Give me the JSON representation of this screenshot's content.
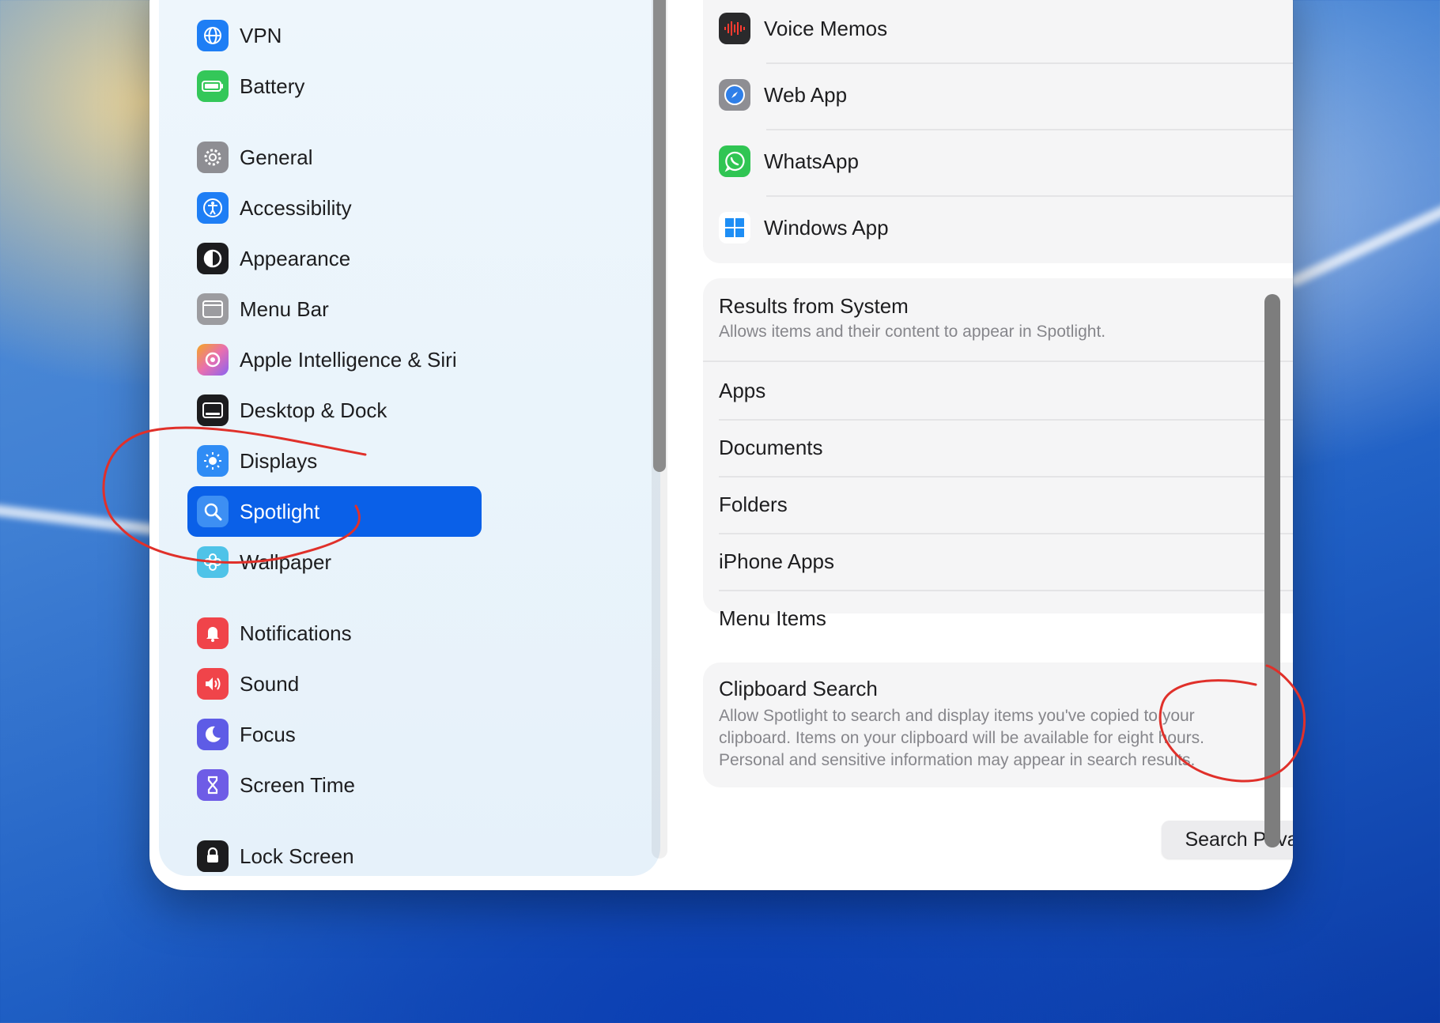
{
  "sidebar": {
    "items": [
      {
        "label": "VPN",
        "icon": "globe-icon",
        "color": "#1e7ef5"
      },
      {
        "label": "Battery",
        "icon": "battery-icon",
        "color": "#34c759"
      },
      {
        "label": "General",
        "icon": "gear-icon",
        "color": "#8e8e93"
      },
      {
        "label": "Accessibility",
        "icon": "accessibility-icon",
        "color": "#1e7ef5"
      },
      {
        "label": "Appearance",
        "icon": "appearance-icon",
        "color": "#1c1c1e"
      },
      {
        "label": "Menu Bar",
        "icon": "menu-bar-icon",
        "color": "#9c9ca0"
      },
      {
        "label": "Apple Intelligence & Siri",
        "icon": "apple-intelligence-icon",
        "color": "#e86fb0"
      },
      {
        "label": "Desktop & Dock",
        "icon": "desktop-dock-icon",
        "color": "#1c1c1e"
      },
      {
        "label": "Displays",
        "icon": "sun-icon",
        "color": "#2f8cf5"
      },
      {
        "label": "Spotlight",
        "icon": "magnifier-icon",
        "color": "#2e84f0",
        "selected": true
      },
      {
        "label": "Wallpaper",
        "icon": "flower-icon",
        "color": "#4fc3e8"
      },
      {
        "label": "Notifications",
        "icon": "bell-icon",
        "color": "#f0444a"
      },
      {
        "label": "Sound",
        "icon": "speaker-icon",
        "color": "#f0444a"
      },
      {
        "label": "Focus",
        "icon": "moon-icon",
        "color": "#5e5ce6"
      },
      {
        "label": "Screen Time",
        "icon": "hourglass-icon",
        "color": "#6e5ce6"
      },
      {
        "label": "Lock Screen",
        "icon": "lock-icon",
        "color": "#1c1c1e"
      }
    ]
  },
  "apps_card": {
    "rows": [
      {
        "label": "Voice Memos",
        "icon": "voice-memos-icon",
        "color": "#2a2a2c",
        "on": true
      },
      {
        "label": "Web App",
        "icon": "compass-icon",
        "color": "#2f7fe8",
        "on": true
      },
      {
        "label": "WhatsApp",
        "icon": "whatsapp-icon",
        "color": "#30c553",
        "on": true
      },
      {
        "label": "Windows App",
        "icon": "windows-icon",
        "color": "#1e8ef5",
        "on": true
      }
    ]
  },
  "system_card": {
    "title": "Results from System",
    "description": "Allows items and their content to appear in Spotlight.",
    "rows": [
      {
        "label": "Apps",
        "on": true
      },
      {
        "label": "Documents",
        "on": true,
        "info": true
      },
      {
        "label": "Folders",
        "on": true
      },
      {
        "label": "iPhone Apps",
        "on": false
      },
      {
        "label": "Menu Items",
        "on": true
      }
    ]
  },
  "clipboard_card": {
    "title": "Clipboard Search",
    "description_lines": [
      "Allow Spotlight to search and display items you've copied to your",
      "clipboard. Items on your clipboard will be available for eight hours.",
      "Personal and sensitive information may appear in search results."
    ],
    "on": true
  },
  "footer": {
    "privacy_button": "Search Privacy...",
    "help_button": "?"
  },
  "colors": {
    "accent": "#0a64e6",
    "selection": "#0a60e8",
    "annotation": "#e0302a"
  }
}
